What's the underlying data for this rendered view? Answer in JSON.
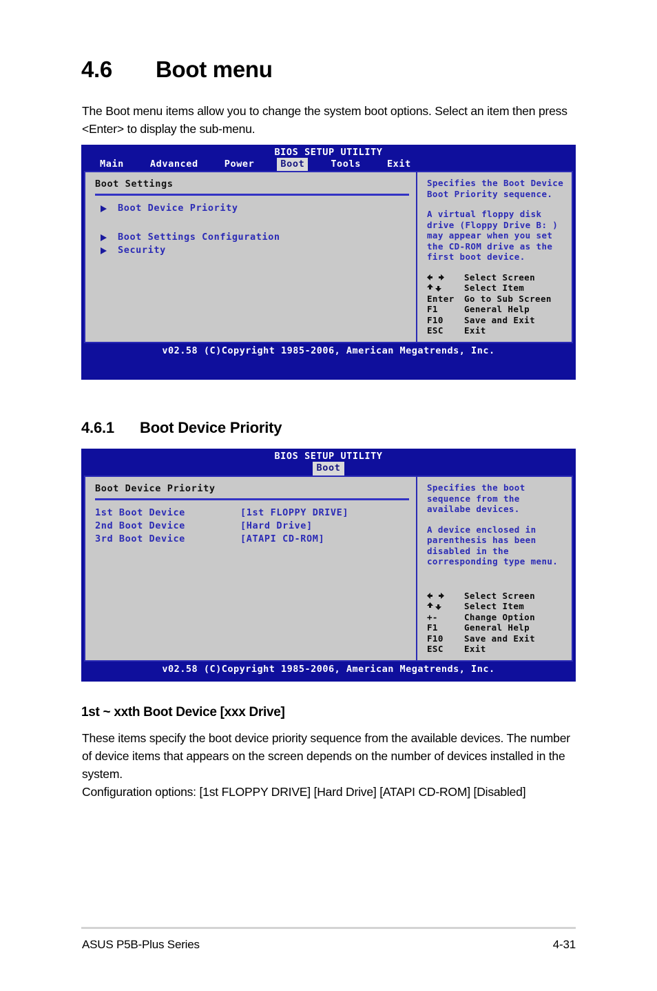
{
  "document": {
    "section_46": {
      "number": "4.6",
      "title": "Boot menu",
      "intro": "The Boot menu items allow you to change the system boot options. Select an item then press <Enter> to display the sub-menu."
    },
    "section_461": {
      "number": "4.6.1",
      "title": "Boot Device Priority",
      "subheading": "1st ~ xxth Boot Device [xxx Drive]",
      "paragraph_1": "These items specify the boot device priority sequence from the available devices. The number of device items that appears on the screen depends on the number of devices installed in the system.",
      "paragraph_2": "Configuration options: [1st FLOPPY DRIVE] [Hard Drive] [ATAPI CD-ROM] [Disabled]"
    }
  },
  "bios_screen_1": {
    "title": "BIOS SETUP UTILITY",
    "menubar": [
      {
        "label": "Main",
        "active": false
      },
      {
        "label": "Advanced",
        "active": false
      },
      {
        "label": "Power",
        "active": false
      },
      {
        "label": "Boot",
        "active": true
      },
      {
        "label": "Tools",
        "active": false
      },
      {
        "label": "Exit",
        "active": false
      }
    ],
    "panel_title": "Boot Settings",
    "menu_items": [
      {
        "label": "Boot Device Priority"
      },
      {
        "label": "Boot Settings Configuration"
      },
      {
        "label": "Security"
      }
    ],
    "help": {
      "para_1": "Specifies the Boot Device Boot Priority sequence.",
      "para_2": "A virtual floppy disk drive (Floppy Drive B: ) may appear when you set the CD-ROM drive as the first boot device."
    },
    "legend": [
      {
        "key": "",
        "key_icon": "left-right-arrows-icon",
        "action": "Select Screen"
      },
      {
        "key": "",
        "key_icon": "up-down-arrows-icon",
        "action": "Select Item"
      },
      {
        "key": "Enter",
        "key_icon": "",
        "action": "Go to Sub Screen"
      },
      {
        "key": "F1",
        "key_icon": "",
        "action": "General Help"
      },
      {
        "key": "F10",
        "key_icon": "",
        "action": "Save and Exit"
      },
      {
        "key": "ESC",
        "key_icon": "",
        "action": "Exit"
      }
    ],
    "footer": "v02.58 (C)Copyright 1985-2006, American Megatrends, Inc."
  },
  "bios_screen_2": {
    "title": "BIOS SETUP UTILITY",
    "subtab": "Boot",
    "panel_title": "Boot Device Priority",
    "devices": [
      {
        "name": "1st Boot Device",
        "value": "[1st FLOPPY DRIVE]"
      },
      {
        "name": "2nd Boot Device",
        "value": "[Hard Drive]"
      },
      {
        "name": "3rd Boot Device",
        "value": "[ATAPI CD-ROM]"
      }
    ],
    "help": {
      "para_1": "Specifies the boot sequence from the availabe devices.",
      "para_2": "A device enclosed in parenthesis has been disabled in the corresponding type menu."
    },
    "legend": [
      {
        "key": "",
        "key_icon": "left-right-arrows-icon",
        "action": "Select Screen"
      },
      {
        "key": "",
        "key_icon": "up-down-arrows-icon",
        "action": "Select Item"
      },
      {
        "key": "+-",
        "key_icon": "",
        "action": "Change Option"
      },
      {
        "key": "F1",
        "key_icon": "",
        "action": "General Help"
      },
      {
        "key": "F10",
        "key_icon": "",
        "action": "Save and Exit"
      },
      {
        "key": "ESC",
        "key_icon": "",
        "action": "Exit"
      }
    ],
    "footer": "v02.58 (C)Copyright 1985-2006, American Megatrends, Inc."
  },
  "page_footer": {
    "left": "ASUS P5B-Plus Series",
    "right": "4-31"
  },
  "colors": {
    "bios_background": "#0f0f9c",
    "panel_background": "#c9c9c9",
    "panel_border": "#2a2ab4",
    "bios_text": "#2b2bb5",
    "active_tab_background": "#d9d9d9"
  }
}
